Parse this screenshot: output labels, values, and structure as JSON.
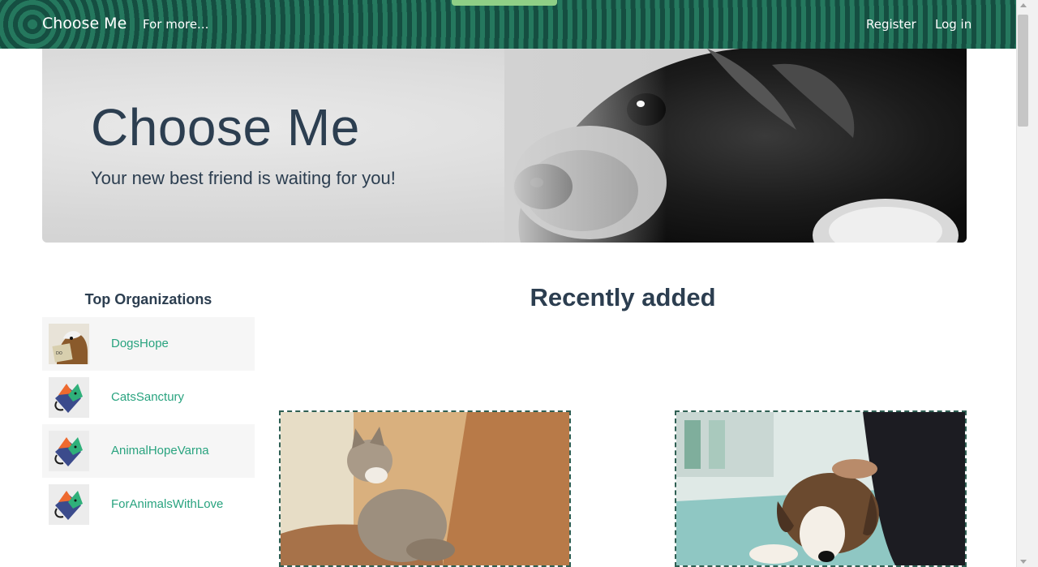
{
  "navbar": {
    "brand": "Choose Me",
    "more_label": "For more...",
    "register_label": "Register",
    "login_label": "Log in"
  },
  "hero": {
    "title": "Choose Me",
    "subtitle": "Your new best friend is waiting for you!"
  },
  "sidebar": {
    "heading": "Top Organizations",
    "organizations": [
      {
        "name": "DogsHope",
        "icon": "dog-photo-thumb"
      },
      {
        "name": "CatsSanctury",
        "icon": "cat-logo-thumb"
      },
      {
        "name": "AnimalHopeVarna",
        "icon": "cat-logo-thumb"
      },
      {
        "name": "ForAnimalsWithLove",
        "icon": "cat-logo-thumb"
      }
    ]
  },
  "main": {
    "heading": "Recently added",
    "cards": [
      {
        "image": "kitten-photo"
      },
      {
        "image": "puppy-photo"
      }
    ]
  },
  "colors": {
    "navbar": "#1f6b55",
    "accent_link": "#29a37f",
    "heading_text": "#2c3e50",
    "card_border": "#2f5f53"
  }
}
